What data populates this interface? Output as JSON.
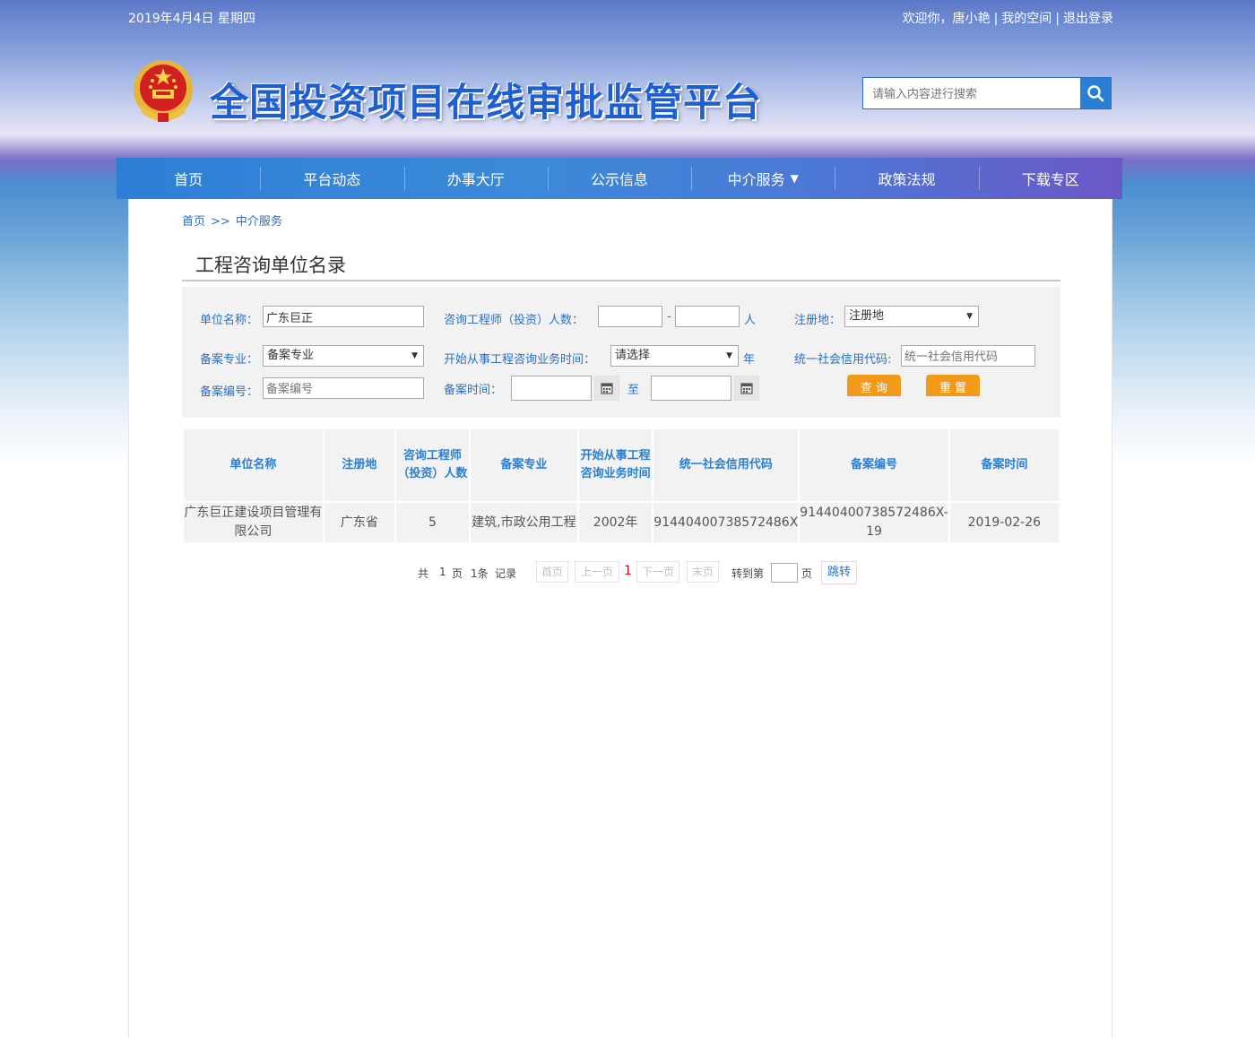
{
  "header": {
    "date": "2019年4月4日 星期四",
    "welcome": "欢迎你，唐小艳",
    "my_space": "我的空间",
    "logout": "退出登录",
    "site_title": "全国投资项目在线审批监管平台",
    "search_placeholder": "请输入内容进行搜索"
  },
  "nav": {
    "items": [
      {
        "label": "首页"
      },
      {
        "label": "平台动态"
      },
      {
        "label": "办事大厅"
      },
      {
        "label": "公示信息"
      },
      {
        "label": "中介服务",
        "dropdown": "▼"
      },
      {
        "label": "政策法规"
      },
      {
        "label": "下载专区"
      }
    ]
  },
  "breadcrumb": {
    "home": "首页",
    "separator": ">>",
    "current": "中介服务"
  },
  "page_title": "工程咨询单位名录",
  "filter": {
    "unit_name_label": "单位名称：",
    "unit_name_value": "广东巨正",
    "engineer_count_label": "咨询工程师（投资）人数：",
    "range_sep": "-",
    "person_unit": "人",
    "region_label": "注册地：",
    "region_selected": "注册地",
    "specialty_label": "备案专业：",
    "specialty_selected": "备案专业",
    "start_time_label": "开始从事工程咨询业务时间：",
    "start_time_selected": "请选择",
    "year_unit": "年",
    "credit_code_label": "统一社会信用代码:",
    "credit_code_placeholder": "统一社会信用代码",
    "record_no_label": "备案编号：",
    "record_no_placeholder": "备案编号",
    "record_time_label": "备案时间：",
    "to": "至",
    "query_button": "查 询",
    "reset_button": "重 置"
  },
  "table": {
    "headers": [
      "单位名称",
      "注册地",
      "咨询工程师（投资）人数",
      "备案专业",
      "开始从事工程咨询业务时间",
      "统一社会信用代码",
      "备案编号",
      "备案时间"
    ],
    "rows": [
      [
        "广东巨正建设项目管理有限公司",
        "广东省",
        "5",
        "建筑,市政公用工程",
        "2002年",
        "91440400738572486X",
        "91440400738572486X-19",
        "2019-02-26"
      ]
    ]
  },
  "pager": {
    "total_prefix": "共",
    "total_pages": "1",
    "page_word": "页",
    "total_records": "1条",
    "records_word": "记录",
    "first": "首页",
    "prev": "上一页",
    "current": "1",
    "next": "下一页",
    "last": "末页",
    "goto_label": "转到第",
    "goto_suffix": "页",
    "go_button": "跳转"
  },
  "colors": {
    "accent_blue": "#2a7fd4",
    "button_orange": "#f39a1b",
    "current_page_red": "#e3001b"
  }
}
